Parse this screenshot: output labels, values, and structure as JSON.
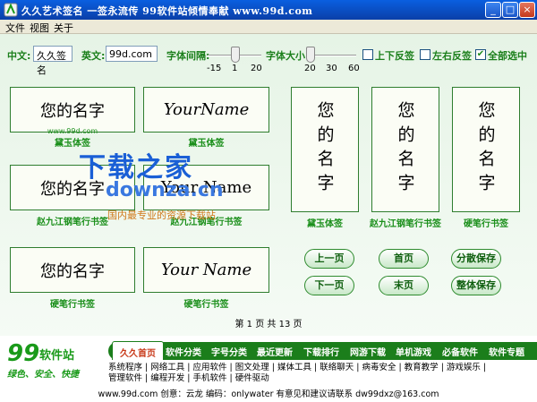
{
  "window": {
    "title": "久久艺术签名  一签永流传  99软件站倾情奉献 www.99d.com",
    "minimize": "_",
    "maximize": "□",
    "close": "×"
  },
  "menu": [
    "文件",
    "视图",
    "关于"
  ],
  "toolbar": {
    "cn_label": "中文:",
    "cn_value": "久久签名",
    "en_label": "英文:",
    "en_value": "99d.com",
    "spacing_label": "字体间隔:",
    "spacing_ticks": [
      "-15",
      "1",
      "20"
    ],
    "spacing_value": 1,
    "size_label": "字体大小",
    "size_ticks": [
      "20",
      "30",
      "60"
    ],
    "size_value": 20,
    "flip_vertical_label": "上下反签",
    "flip_vertical_checked": false,
    "flip_horizontal_label": "左右反签",
    "flip_horizontal_checked": false,
    "select_all_label": "全部选中",
    "select_all_checked": true
  },
  "cards": [
    {
      "text": "您的名字",
      "caption": "黛玉体签",
      "url": "www.99d.com"
    },
    {
      "text": "YourName",
      "caption": "黛玉体签",
      "url": ""
    },
    {
      "text": "您的名字",
      "caption": "黛玉体签",
      "url": ""
    },
    {
      "text": "您的名字",
      "caption": "赵九江钢笔行书签",
      "url": ""
    },
    {
      "text": "您的名字",
      "caption": "硬笔行书签",
      "url": ""
    },
    {
      "text": "您的名字",
      "caption": "赵九江钢笔行书签",
      "url": ""
    },
    {
      "text": "Your Name",
      "caption": "赵九江钢笔行书签",
      "url": ""
    },
    {
      "text": "您的名字",
      "caption": "硬笔行书签",
      "url": ""
    },
    {
      "text": "Your Name",
      "caption": "硬笔行书签",
      "url": ""
    }
  ],
  "watermark": {
    "title": "下载之家",
    "domain": "downza.cn",
    "slogan": "国内最专业的资源下载站"
  },
  "buttons": {
    "prev": "上一页",
    "first": "首页",
    "save_category": "分散保存",
    "next": "下一页",
    "last": "末页",
    "save_all": "整体保存"
  },
  "pagination": "第 1 页 共 13 页",
  "site": {
    "logo_number": "99",
    "logo_brand": "软件站",
    "logo_slogan": "绿色、安全、快捷",
    "nav": [
      "久久首页",
      "软件分类",
      "字号分类",
      "最近更新",
      "下载排行",
      "网游下载",
      "单机游戏",
      "必备软件",
      "软件专题"
    ],
    "links_line1": "系统程序 | 网络工具 | 应用软件 | 图文处理 | 媒体工具 | 联络聊天 | 病毒安全 | 教育教学 | 游戏娱乐 |",
    "links_line2": "管理软件 | 编程开发 | 手机软件 | 硬件驱动",
    "footer": "www.99d.com  创意：云龙   编码：onlywater 有意见和建议请联系 dw99dxz@163.com"
  },
  "colors": {
    "titlebar": "#0a5fe0",
    "accent_green": "#1b7f1b",
    "watermark_blue": "#1a5fd6"
  }
}
